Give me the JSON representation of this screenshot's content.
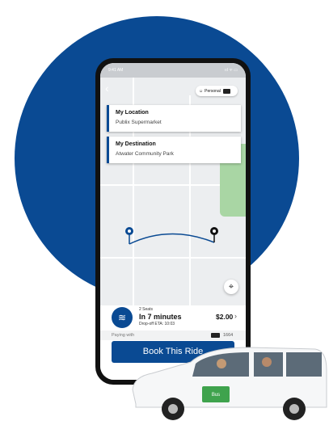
{
  "status_bar": {
    "time": "9:41 AM",
    "indicators": "ııl ᯤ ▭"
  },
  "header": {
    "profile_label": "Personal",
    "back_icon": "back-arrow-icon",
    "profile_icon": "person-icon"
  },
  "pickup": {
    "title": "My Location",
    "value": "Publix Supermarket"
  },
  "destination": {
    "title": "My Destination",
    "value": "Atwater Community Park"
  },
  "ride": {
    "seats": "2 Seats",
    "arrival": "In 7 minutes",
    "eta": "Drop-off ETA: 10:03",
    "price": "$2.00",
    "chevron": "›"
  },
  "payment": {
    "label": "Paying with",
    "card": "1664"
  },
  "actions": {
    "book_label": "Book This Ride"
  },
  "van": {
    "logo_text": "Bus"
  },
  "colors": {
    "brand": "#0a4a93",
    "park": "#a9d6a4",
    "map": "#eceef0"
  }
}
